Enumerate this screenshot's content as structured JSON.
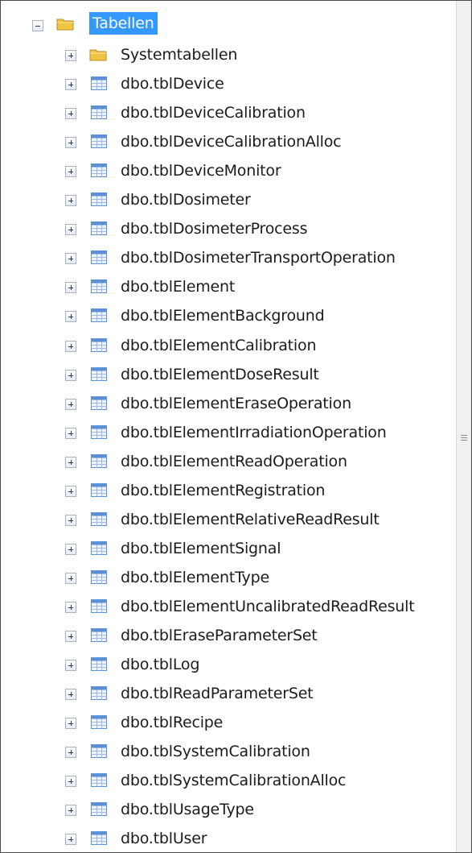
{
  "tree": {
    "root": {
      "label": "Tabellen",
      "icon": "folder-icon",
      "expanded": true
    },
    "children": [
      {
        "label": "Systemtabellen",
        "icon": "folder-icon"
      },
      {
        "label": "dbo.tblDevice",
        "icon": "table-icon"
      },
      {
        "label": "dbo.tblDeviceCalibration",
        "icon": "table-icon"
      },
      {
        "label": "dbo.tblDeviceCalibrationAlloc",
        "icon": "table-icon"
      },
      {
        "label": "dbo.tblDeviceMonitor",
        "icon": "table-icon"
      },
      {
        "label": "dbo.tblDosimeter",
        "icon": "table-icon"
      },
      {
        "label": "dbo.tblDosimeterProcess",
        "icon": "table-icon"
      },
      {
        "label": "dbo.tblDosimeterTransportOperation",
        "icon": "table-icon"
      },
      {
        "label": "dbo.tblElement",
        "icon": "table-icon"
      },
      {
        "label": "dbo.tblElementBackground",
        "icon": "table-icon"
      },
      {
        "label": "dbo.tblElementCalibration",
        "icon": "table-icon"
      },
      {
        "label": "dbo.tblElementDoseResult",
        "icon": "table-icon"
      },
      {
        "label": "dbo.tblElementEraseOperation",
        "icon": "table-icon"
      },
      {
        "label": "dbo.tblElementIrradiationOperation",
        "icon": "table-icon"
      },
      {
        "label": "dbo.tblElementReadOperation",
        "icon": "table-icon"
      },
      {
        "label": "dbo.tblElementRegistration",
        "icon": "table-icon"
      },
      {
        "label": "dbo.tblElementRelativeReadResult",
        "icon": "table-icon"
      },
      {
        "label": "dbo.tblElementSignal",
        "icon": "table-icon"
      },
      {
        "label": "dbo.tblElementType",
        "icon": "table-icon"
      },
      {
        "label": "dbo.tblElementUncalibratedReadResult",
        "icon": "table-icon"
      },
      {
        "label": "dbo.tblEraseParameterSet",
        "icon": "table-icon"
      },
      {
        "label": "dbo.tblLog",
        "icon": "table-icon"
      },
      {
        "label": "dbo.tblReadParameterSet",
        "icon": "table-icon"
      },
      {
        "label": "dbo.tblRecipe",
        "icon": "table-icon"
      },
      {
        "label": "dbo.tblSystemCalibration",
        "icon": "table-icon"
      },
      {
        "label": "dbo.tblSystemCalibrationAlloc",
        "icon": "table-icon"
      },
      {
        "label": "dbo.tblUsageType",
        "icon": "table-icon"
      },
      {
        "label": "dbo.tblUser",
        "icon": "table-icon"
      }
    ]
  },
  "colors": {
    "selection": "#3399ff",
    "folder": "#f0c542",
    "table_header": "#5b8fd6"
  }
}
